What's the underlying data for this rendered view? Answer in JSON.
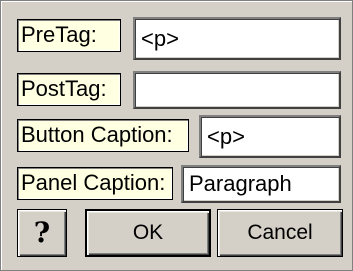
{
  "fields": {
    "pretag": {
      "label": "PreTag:",
      "value": "<p>"
    },
    "posttag": {
      "label": "PostTag:",
      "value": ""
    },
    "button_caption": {
      "label": "Button Caption:",
      "value": "<p>"
    },
    "panel_caption": {
      "label": "Panel Caption:",
      "value": "Paragraph"
    }
  },
  "buttons": {
    "help_icon": "question-mark-icon",
    "help_glyph": "?",
    "ok": "OK",
    "cancel": "Cancel"
  },
  "colors": {
    "dialog_bg": "#d4d0c8",
    "label_bg": "#ffffe1",
    "field_bg": "#ffffff"
  }
}
